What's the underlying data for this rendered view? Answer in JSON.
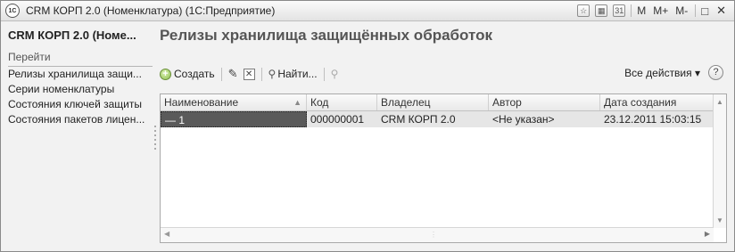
{
  "window": {
    "title": "CRM КОРП 2.0 (Номенклатура) (1С:Предприятие)",
    "logo_text": "1С",
    "controls": {
      "m": "M",
      "m_plus": "M+",
      "m_minus": "M-",
      "maximize": "□",
      "close": "✕"
    }
  },
  "sidebar": {
    "title": "CRM КОРП 2.0 (Номе...",
    "goto_label": "Перейти",
    "items": [
      {
        "label": "Релизы хранилища защи..."
      },
      {
        "label": "Серии номенклатуры"
      },
      {
        "label": "Состояния ключей защиты"
      },
      {
        "label": "Состояния пакетов лицен..."
      }
    ]
  },
  "form": {
    "title": "Релизы хранилища защищённых обработок"
  },
  "toolbar": {
    "create_label": "Создать",
    "find_label": "Найти...",
    "all_actions_label": "Все действия ▾",
    "help_label": "?"
  },
  "table": {
    "columns": [
      {
        "label": "Наименование"
      },
      {
        "label": "Код"
      },
      {
        "label": "Владелец"
      },
      {
        "label": "Автор"
      },
      {
        "label": "Дата создания"
      }
    ],
    "rows": [
      {
        "name": "— 1",
        "code": "000000001",
        "owner": "CRM КОРП 2.0",
        "author": "<Не указан>",
        "created": "23.12.2011 15:03:15"
      }
    ]
  }
}
